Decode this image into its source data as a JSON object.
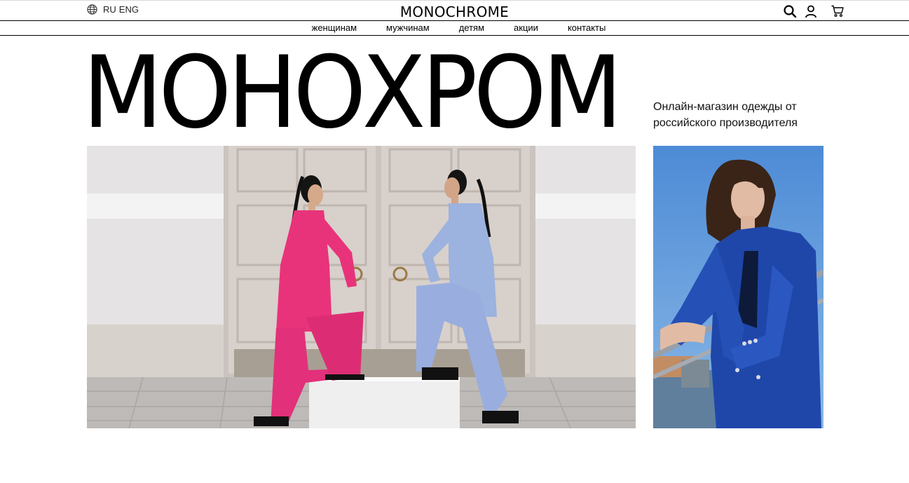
{
  "header": {
    "lang_ru": "RU",
    "lang_eng": "ENG",
    "logo": "MONOCHROME"
  },
  "nav": {
    "items": [
      "женщинам",
      "мужчинам",
      "детям",
      "акции",
      "контакты"
    ]
  },
  "hero": {
    "title": "МОНОХРОМ",
    "tagline_line1": "Онлайн-магазин одежды от",
    "tagline_line2": "российского производителя"
  },
  "icons": [
    "globe-icon",
    "search-icon",
    "user-icon",
    "cart-icon"
  ],
  "colors": {
    "pink_suit": "#e8337a",
    "blue_suit": "#9bb0dd",
    "cobalt_jacket": "#1e45a8",
    "sky": "#5b93d6",
    "wall": "#e7e4e4",
    "door": "#d6cec9"
  }
}
